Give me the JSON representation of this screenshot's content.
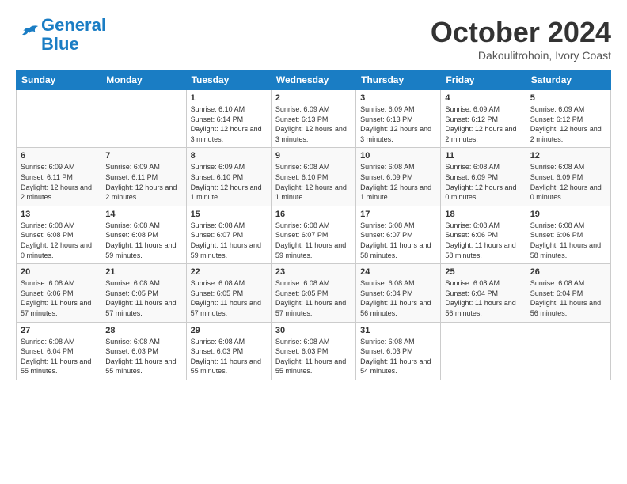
{
  "header": {
    "logo_line1": "General",
    "logo_line2": "Blue",
    "month": "October 2024",
    "location": "Dakoulitrohoin, Ivory Coast"
  },
  "days_of_week": [
    "Sunday",
    "Monday",
    "Tuesday",
    "Wednesday",
    "Thursday",
    "Friday",
    "Saturday"
  ],
  "weeks": [
    [
      {
        "day": "",
        "info": ""
      },
      {
        "day": "",
        "info": ""
      },
      {
        "day": "1",
        "info": "Sunrise: 6:10 AM\nSunset: 6:14 PM\nDaylight: 12 hours and 3 minutes."
      },
      {
        "day": "2",
        "info": "Sunrise: 6:09 AM\nSunset: 6:13 PM\nDaylight: 12 hours and 3 minutes."
      },
      {
        "day": "3",
        "info": "Sunrise: 6:09 AM\nSunset: 6:13 PM\nDaylight: 12 hours and 3 minutes."
      },
      {
        "day": "4",
        "info": "Sunrise: 6:09 AM\nSunset: 6:12 PM\nDaylight: 12 hours and 2 minutes."
      },
      {
        "day": "5",
        "info": "Sunrise: 6:09 AM\nSunset: 6:12 PM\nDaylight: 12 hours and 2 minutes."
      }
    ],
    [
      {
        "day": "6",
        "info": "Sunrise: 6:09 AM\nSunset: 6:11 PM\nDaylight: 12 hours and 2 minutes."
      },
      {
        "day": "7",
        "info": "Sunrise: 6:09 AM\nSunset: 6:11 PM\nDaylight: 12 hours and 2 minutes."
      },
      {
        "day": "8",
        "info": "Sunrise: 6:09 AM\nSunset: 6:10 PM\nDaylight: 12 hours and 1 minute."
      },
      {
        "day": "9",
        "info": "Sunrise: 6:08 AM\nSunset: 6:10 PM\nDaylight: 12 hours and 1 minute."
      },
      {
        "day": "10",
        "info": "Sunrise: 6:08 AM\nSunset: 6:09 PM\nDaylight: 12 hours and 1 minute."
      },
      {
        "day": "11",
        "info": "Sunrise: 6:08 AM\nSunset: 6:09 PM\nDaylight: 12 hours and 0 minutes."
      },
      {
        "day": "12",
        "info": "Sunrise: 6:08 AM\nSunset: 6:09 PM\nDaylight: 12 hours and 0 minutes."
      }
    ],
    [
      {
        "day": "13",
        "info": "Sunrise: 6:08 AM\nSunset: 6:08 PM\nDaylight: 12 hours and 0 minutes."
      },
      {
        "day": "14",
        "info": "Sunrise: 6:08 AM\nSunset: 6:08 PM\nDaylight: 11 hours and 59 minutes."
      },
      {
        "day": "15",
        "info": "Sunrise: 6:08 AM\nSunset: 6:07 PM\nDaylight: 11 hours and 59 minutes."
      },
      {
        "day": "16",
        "info": "Sunrise: 6:08 AM\nSunset: 6:07 PM\nDaylight: 11 hours and 59 minutes."
      },
      {
        "day": "17",
        "info": "Sunrise: 6:08 AM\nSunset: 6:07 PM\nDaylight: 11 hours and 58 minutes."
      },
      {
        "day": "18",
        "info": "Sunrise: 6:08 AM\nSunset: 6:06 PM\nDaylight: 11 hours and 58 minutes."
      },
      {
        "day": "19",
        "info": "Sunrise: 6:08 AM\nSunset: 6:06 PM\nDaylight: 11 hours and 58 minutes."
      }
    ],
    [
      {
        "day": "20",
        "info": "Sunrise: 6:08 AM\nSunset: 6:06 PM\nDaylight: 11 hours and 57 minutes."
      },
      {
        "day": "21",
        "info": "Sunrise: 6:08 AM\nSunset: 6:05 PM\nDaylight: 11 hours and 57 minutes."
      },
      {
        "day": "22",
        "info": "Sunrise: 6:08 AM\nSunset: 6:05 PM\nDaylight: 11 hours and 57 minutes."
      },
      {
        "day": "23",
        "info": "Sunrise: 6:08 AM\nSunset: 6:05 PM\nDaylight: 11 hours and 57 minutes."
      },
      {
        "day": "24",
        "info": "Sunrise: 6:08 AM\nSunset: 6:04 PM\nDaylight: 11 hours and 56 minutes."
      },
      {
        "day": "25",
        "info": "Sunrise: 6:08 AM\nSunset: 6:04 PM\nDaylight: 11 hours and 56 minutes."
      },
      {
        "day": "26",
        "info": "Sunrise: 6:08 AM\nSunset: 6:04 PM\nDaylight: 11 hours and 56 minutes."
      }
    ],
    [
      {
        "day": "27",
        "info": "Sunrise: 6:08 AM\nSunset: 6:04 PM\nDaylight: 11 hours and 55 minutes."
      },
      {
        "day": "28",
        "info": "Sunrise: 6:08 AM\nSunset: 6:03 PM\nDaylight: 11 hours and 55 minutes."
      },
      {
        "day": "29",
        "info": "Sunrise: 6:08 AM\nSunset: 6:03 PM\nDaylight: 11 hours and 55 minutes."
      },
      {
        "day": "30",
        "info": "Sunrise: 6:08 AM\nSunset: 6:03 PM\nDaylight: 11 hours and 55 minutes."
      },
      {
        "day": "31",
        "info": "Sunrise: 6:08 AM\nSunset: 6:03 PM\nDaylight: 11 hours and 54 minutes."
      },
      {
        "day": "",
        "info": ""
      },
      {
        "day": "",
        "info": ""
      }
    ]
  ]
}
